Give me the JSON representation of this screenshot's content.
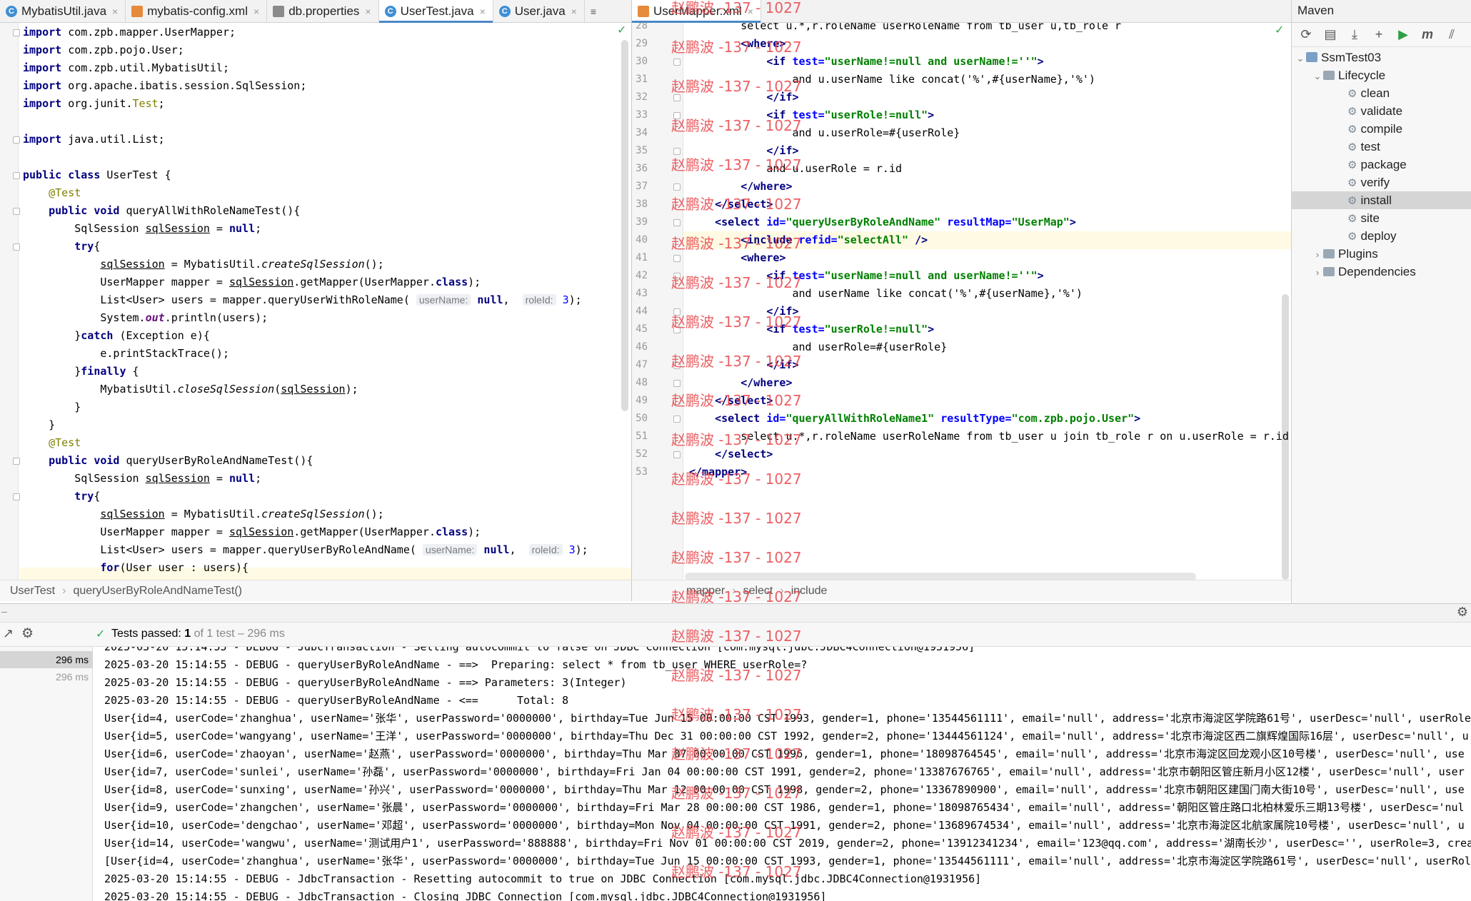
{
  "left_tabs": [
    {
      "label": "MybatisUtil.java",
      "type": "java",
      "active": false
    },
    {
      "label": "mybatis-config.xml",
      "type": "xml",
      "active": false
    },
    {
      "label": "db.properties",
      "type": "props",
      "active": false
    },
    {
      "label": "UserTest.java",
      "type": "java",
      "active": true
    },
    {
      "label": "User.java",
      "type": "java",
      "active": false
    }
  ],
  "left_tabs_extra": "≡",
  "right_tabs": [
    {
      "label": "UserMapper.xml",
      "type": "xml",
      "active": true
    }
  ],
  "left_code": [
    "<span class='kw'>import</span> com.zpb.mapper.UserMapper;",
    "<span class='kw'>import</span> com.zpb.pojo.User;",
    "<span class='kw'>import</span> com.zpb.util.MybatisUtil;",
    "<span class='kw'>import</span> org.apache.ibatis.session.SqlSession;",
    "<span class='kw'>import</span> org.junit.<span class='ann'>Test</span>;",
    "",
    "<span class='kw'>import</span> java.util.List;",
    "",
    "<span class='kw'>public class</span> UserTest {",
    "    <span class='ann'>@Test</span>",
    "    <span class='kw'>public void</span> queryAllWithRoleNameTest(){",
    "        SqlSession <span class='ul'>sqlSession</span> = <span class='kw'>null</span>;",
    "        <span class='kw'>try</span>{",
    "            <span class='ul'>sqlSession</span> = MybatisUtil.<span class='ital'>createSqlSession</span>();",
    "            UserMapper mapper = <span class='ul'>sqlSession</span>.getMapper(UserMapper.<span class='kw'>class</span>);",
    "            List&lt;User&gt; users = mapper.queryUserWithRoleName( <span class='hint'>userName:</span> <span class='kw'>null</span>,  <span class='hint'>roleId:</span> <span class='num'>3</span>);",
    "            System.<span class='statf'>out</span>.println(users);",
    "        }<span class='kw'>catch</span> (Exception e){",
    "            e.printStackTrace();",
    "        }<span class='kw'>finally</span> {",
    "            MybatisUtil.<span class='ital'>closeSqlSession</span>(<span class='ul'>sqlSession</span>);",
    "        }",
    "    }",
    "    <span class='ann'>@Test</span>",
    "    <span class='kw'>public void</span> queryUserByRoleAndNameTest(){",
    "        SqlSession <span class='ul'>sqlSession</span> = <span class='kw'>null</span>;",
    "        <span class='kw'>try</span>{",
    "            <span class='ul'>sqlSession</span> = MybatisUtil.<span class='ital'>createSqlSession</span>();",
    "            UserMapper mapper = <span class='ul'>sqlSession</span>.getMapper(UserMapper.<span class='kw'>class</span>);",
    "            List&lt;User&gt; users = mapper.queryUserByRoleAndName( <span class='hint'>userName:</span> <span class='kw'>null</span>,  <span class='hint'>roleId:</span> <span class='num'>3</span>);",
    "            <span class='kw'>for</span>(User user : users){"
  ],
  "right_code": [
    {
      "n": "28",
      "t": "        select u.*,r.roleName userRoleName from tb_user u,tb_role r"
    },
    {
      "n": "29",
      "t": "        <span class='tag'>&lt;where&gt;</span>"
    },
    {
      "n": "30",
      "t": "            <span class='tag'>&lt;if</span> <span class='attr'>test=</span><span class='aval'>\"userName!=null and userName!=''\"</span><span class='tag'>&gt;</span>"
    },
    {
      "n": "31",
      "t": "                and u.userName like concat('%',#{userName},'%')"
    },
    {
      "n": "32",
      "t": "            <span class='tag'>&lt;/if&gt;</span>"
    },
    {
      "n": "33",
      "t": "            <span class='tag'>&lt;if</span> <span class='attr'>test=</span><span class='aval'>\"userRole!=null\"</span><span class='tag'>&gt;</span>"
    },
    {
      "n": "34",
      "t": "                and u.userRole=#{userRole}"
    },
    {
      "n": "35",
      "t": "            <span class='tag'>&lt;/if&gt;</span>"
    },
    {
      "n": "36",
      "t": "            and u.userRole = r.id"
    },
    {
      "n": "37",
      "t": "        <span class='tag'>&lt;/where&gt;</span>"
    },
    {
      "n": "38",
      "t": "    <span class='tag'>&lt;/select&gt;</span>"
    },
    {
      "n": "39",
      "t": "    <span class='tag'>&lt;select</span> <span class='attr'>id=</span><span class='aval'>\"queryUserByRoleAndName\"</span> <span class='attr'>resultMap=</span><span class='aval'>\"UserMap\"</span><span class='tag'>&gt;</span>"
    },
    {
      "n": "40",
      "t": "        <span class='tag'>&lt;include</span> <span class='attr'>refid=</span><span class='aval'>\"selectAll\"</span> <span class='tag'>/&gt;</span>"
    },
    {
      "n": "41",
      "t": "        <span class='tag'>&lt;where&gt;</span>"
    },
    {
      "n": "42",
      "t": "            <span class='tag'>&lt;if</span> <span class='attr'>test=</span><span class='aval'>\"userName!=null and userName!=''\"</span><span class='tag'>&gt;</span>"
    },
    {
      "n": "43",
      "t": "                and userName like concat('%',#{userName},'%')"
    },
    {
      "n": "44",
      "t": "            <span class='tag'>&lt;/if&gt;</span>"
    },
    {
      "n": "45",
      "t": "            <span class='tag'>&lt;if</span> <span class='attr'>test=</span><span class='aval'>\"userRole!=null\"</span><span class='tag'>&gt;</span>"
    },
    {
      "n": "46",
      "t": "                and userRole=#{userRole}"
    },
    {
      "n": "47",
      "t": "            <span class='tag'>&lt;/if&gt;</span>"
    },
    {
      "n": "48",
      "t": "        <span class='tag'>&lt;/where&gt;</span>"
    },
    {
      "n": "49",
      "t": "    <span class='tag'>&lt;/select&gt;</span>"
    },
    {
      "n": "50",
      "t": "    <span class='tag'>&lt;select</span> <span class='attr'>id=</span><span class='aval'>\"queryAllWithRoleName1\"</span> <span class='attr'>resultType=</span><span class='aval'>\"com.zpb.pojo.User\"</span><span class='tag'>&gt;</span>"
    },
    {
      "n": "51",
      "t": "        select u.*,r.roleName userRoleName from tb_user u join tb_role r on u.userRole = r.id"
    },
    {
      "n": "52",
      "t": "    <span class='tag'>&lt;/select&gt;</span>"
    },
    {
      "n": "53",
      "t": "<span class='tag'>&lt;/mapper&gt;</span>"
    }
  ],
  "left_breadcrumb": [
    "UserTest",
    "queryUserByRoleAndNameTest()"
  ],
  "right_breadcrumb": [
    "mapper",
    "select",
    "include"
  ],
  "maven": {
    "title": "Maven",
    "project": "SsmTest03",
    "lifecycle_label": "Lifecycle",
    "lifecycle": [
      "clean",
      "validate",
      "compile",
      "test",
      "package",
      "verify",
      "install",
      "site",
      "deploy"
    ],
    "selected": "install",
    "plugins_label": "Plugins",
    "dependencies_label": "Dependencies"
  },
  "run": {
    "status_prefix": "Tests passed:",
    "status_count": "1",
    "status_rest": "of 1 test – 296 ms",
    "durations": [
      "296 ms",
      "296 ms"
    ],
    "console": [
      "2025-03-20 15:14:55 - DEBUG - JdbcTransaction - Setting autocommit to false on JDBC Connection [com.mysql.jdbc.JDBC4Connection@1931956]",
      "2025-03-20 15:14:55 - DEBUG - queryUserByRoleAndName - ==>  Preparing: select * from tb_user WHERE userRole=?",
      "2025-03-20 15:14:55 - DEBUG - queryUserByRoleAndName - ==> Parameters: 3(Integer)",
      "2025-03-20 15:14:55 - DEBUG - queryUserByRoleAndName - <==      Total: 8",
      "User{id=4, userCode='zhanghua', userName='张华', userPassword='0000000', birthday=Tue Jun 15 00:00:00 CST 1993, gender=1, phone='13544561111', email='null', address='北京市海淀区学院路61号', userDesc='null', userRole",
      "User{id=5, userCode='wangyang', userName='王洋', userPassword='0000000', birthday=Thu Dec 31 00:00:00 CST 1992, gender=2, phone='13444561124', email='null', address='北京市海淀区西二旗辉煌国际16层', userDesc='null', u",
      "User{id=6, userCode='zhaoyan', userName='赵燕', userPassword='0000000', birthday=Thu Mar 07 00:00:00 CST 1996, gender=1, phone='18098764545', email='null', address='北京市海淀区回龙观小区10号楼', userDesc='null', use",
      "User{id=7, userCode='sunlei', userName='孙磊', userPassword='0000000', birthday=Fri Jan 04 00:00:00 CST 1991, gender=2, phone='13387676765', email='null', address='北京市朝阳区管庄新月小区12楼', userDesc='null', user",
      "User{id=8, userCode='sunxing', userName='孙兴', userPassword='0000000', birthday=Thu Mar 12 00:00:00 CST 1998, gender=2, phone='13367890900', email='null', address='北京市朝阳区建国门南大街10号', userDesc='null', use",
      "User{id=9, userCode='zhangchen', userName='张晨', userPassword='0000000', birthday=Fri Mar 28 00:00:00 CST 1986, gender=1, phone='18098765434', email='null', address='朝阳区管庄路口北柏林爱乐三期13号楼', userDesc='nul",
      "User{id=10, userCode='dengchao', userName='邓超', userPassword='0000000', birthday=Mon Nov 04 00:00:00 CST 1991, gender=2, phone='13689674534', email='null', address='北京市海淀区北航家属院10号楼', userDesc='null', u",
      "User{id=14, userCode='wangwu', userName='测试用户1', userPassword='888888', birthday=Fri Nov 01 00:00:00 CST 2019, gender=2, phone='13912341234', email='123@qq.com', address='湖南长沙', userDesc='', userRole=3, crea",
      "[User{id=4, userCode='zhanghua', userName='张华', userPassword='0000000', birthday=Tue Jun 15 00:00:00 CST 1993, gender=1, phone='13544561111', email='null', address='北京市海淀区学院路61号', userDesc='null', userRol",
      "2025-03-20 15:14:55 - DEBUG - JdbcTransaction - Resetting autocommit to true on JDBC Connection [com.mysql.jdbc.JDBC4Connection@1931956]",
      "2025-03-20 15:14:55 - DEBUG - JdbcTransaction - Closing JDBC Connection [com.mysql.jdbc.JDBC4Connection@1931956]"
    ]
  },
  "watermark": "赵鹏波 -137 - 1027"
}
